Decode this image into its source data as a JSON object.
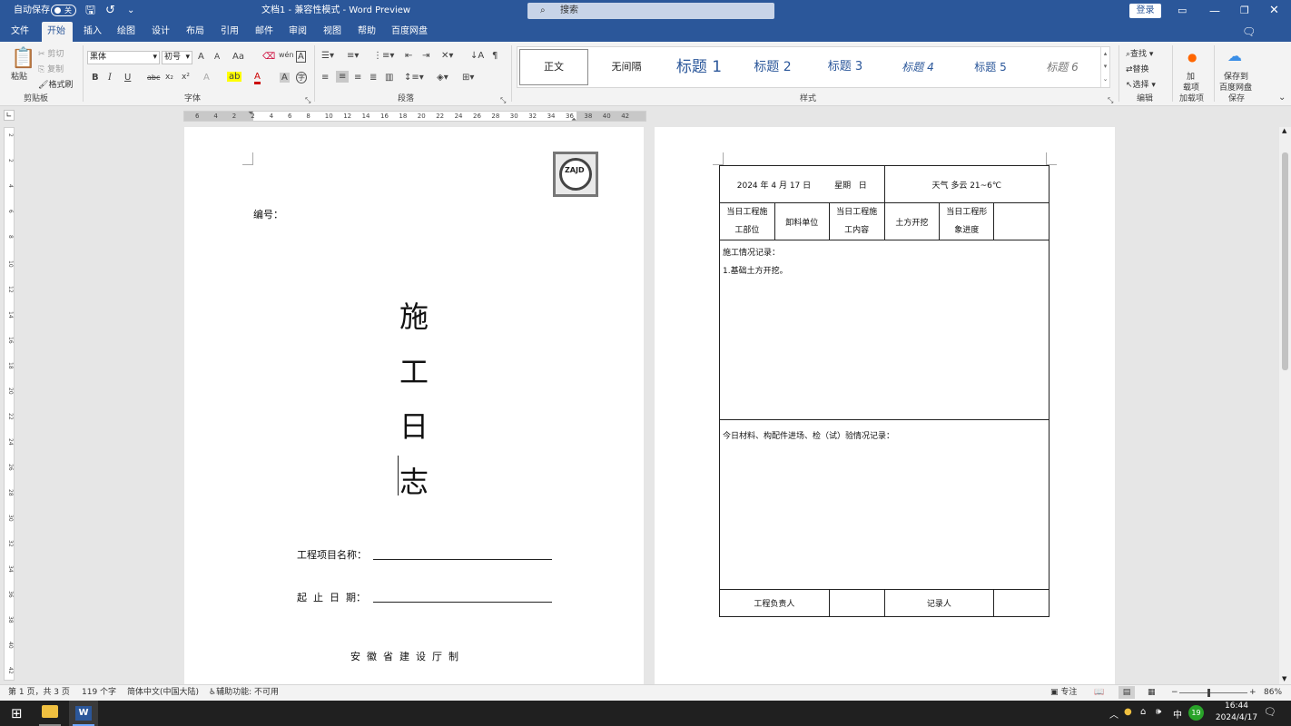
{
  "titlebar": {
    "autosave_label": "自动保存",
    "autosave_state": "关",
    "save_icon": "save-icon",
    "undo_icon": "undo-icon",
    "more_icon": "chevron-down-icon",
    "document_title": "文档1 - 兼容性模式 - Word Preview",
    "search_placeholder": "搜索",
    "login_label": "登录",
    "window_controls": [
      "ribbon-display-icon",
      "minimize-icon",
      "restore-icon",
      "close-icon"
    ]
  },
  "tabs": [
    "文件",
    "开始",
    "插入",
    "绘图",
    "设计",
    "布局",
    "引用",
    "邮件",
    "审阅",
    "视图",
    "帮助",
    "百度网盘"
  ],
  "active_tab": "开始",
  "ribbon": {
    "clipboard": {
      "paste": "粘贴",
      "cut": "剪切",
      "copy": "复制",
      "format_painter": "格式刷",
      "group": "剪贴板"
    },
    "font": {
      "font_name": "黑体",
      "font_size": "初号",
      "group": "字体",
      "aa_label": "Aa",
      "bold": "B",
      "italic": "I",
      "underline": "U",
      "strike": "abc",
      "sub": "x₂",
      "sup": "x²",
      "grow": "A",
      "shrink": "A",
      "clear": "A",
      "wen": "wén",
      "fontcolor": "A",
      "box": "A",
      "circle": "字"
    },
    "paragraph": {
      "group": "段落"
    },
    "styles": {
      "items": [
        "正文",
        "无间隔",
        "标题 1",
        "标题 2",
        "标题 3",
        "标题 4",
        "标题 5",
        "标题 6"
      ],
      "group": "样式"
    },
    "editing": {
      "find": "查找",
      "replace": "替换",
      "select": "选择",
      "group": "编辑"
    },
    "addins": {
      "label1": "加",
      "label2": "载项",
      "group": "加载项"
    },
    "save": {
      "label1": "保存到",
      "label2": "百度网盘",
      "group": "保存"
    }
  },
  "ruler": {
    "h_ticks": [
      "6",
      "4",
      "2",
      "2",
      "4",
      "6",
      "8",
      "10",
      "12",
      "14",
      "16",
      "18",
      "20",
      "22",
      "24",
      "26",
      "28",
      "30",
      "32",
      "34",
      "36",
      "38",
      "40",
      "42"
    ],
    "v_ticks": [
      "2",
      "2",
      "4",
      "6",
      "8",
      "10",
      "12",
      "14",
      "16",
      "18",
      "20",
      "22",
      "24",
      "26",
      "28",
      "30",
      "32",
      "34",
      "36",
      "38",
      "40",
      "42"
    ]
  },
  "page1": {
    "logo_text": "ZAJD",
    "number_label": "编号：",
    "vertical_title": [
      "施",
      "工",
      "日",
      "志"
    ],
    "project_label": "工程项目名称：",
    "date_label": "起  止  日  期：",
    "footer": "安  徽  省  建  设  厅  制"
  },
  "page2": {
    "date": "2024 年 4 月 17 日",
    "weekday": "星期   日",
    "weather": "天气  多云 21~6℃",
    "h1": "当日工程施工部位",
    "h2": "卸料单位",
    "h3": "当日工程施工内容",
    "h4": "土方开挖",
    "h5": "当日工程形象进度",
    "record_label": "施工情况记录：",
    "record_item": "1.基础土方开挖。",
    "materials_label": "今日材料、构配件进场、检（试）验情况记录：",
    "responsible_label": "工程负责人",
    "recorder_label": "记录人"
  },
  "status": {
    "page": "第 1 页，共 3 页",
    "words": "119 个字",
    "lang": "简体中文(中国大陆)",
    "access": "辅助功能: 不可用",
    "focus": "专注",
    "zoom": "86%"
  },
  "taskbar": {
    "time": "16:44",
    "date": "2024/4/17",
    "ime": "中",
    "badge": "19"
  }
}
